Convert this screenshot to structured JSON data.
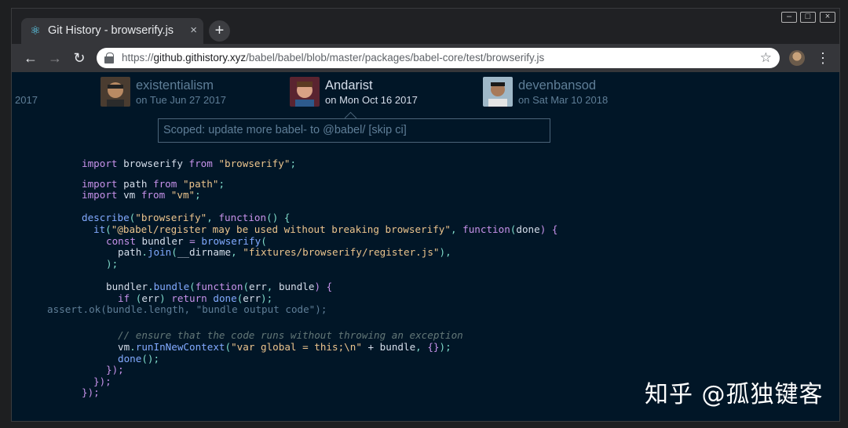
{
  "browser": {
    "tab": {
      "title": "Git History - browserify.js",
      "favicon": "react-icon",
      "close_glyph": "×"
    },
    "new_tab_glyph": "+",
    "window_controls": [
      "minimize",
      "maximize",
      "close"
    ],
    "nav": {
      "back": "←",
      "forward": "→",
      "reload": "↻"
    },
    "url": {
      "scheme": "https://",
      "host": "github.githistory.xyz",
      "path": "/babel/babel/blob/master/packages/babel-core/test/browserify.js"
    },
    "bookmark_glyph": "☆",
    "menu_glyph": "⋮"
  },
  "timeline": {
    "year_stub": "2017",
    "commits": [
      {
        "author": "existentialism",
        "date": "on Tue Jun 27 2017",
        "state": "inactive"
      },
      {
        "author": "Andarist",
        "date": "on Mon Oct 16 2017",
        "state": "active"
      },
      {
        "author": "devenbansod",
        "date": "on Sat Mar 10 2018",
        "state": "inactive"
      }
    ],
    "commit_message": "Scoped: update more babel- to @babel/ [skip ci]"
  },
  "code": {
    "l1": [
      "import",
      " browserify ",
      "from",
      " ",
      "\"browserify\"",
      ";"
    ],
    "l2": [
      "import",
      " path ",
      "from",
      " ",
      "\"path\"",
      ";"
    ],
    "l3": [
      "import",
      " vm ",
      "from",
      " ",
      "\"vm\"",
      ";"
    ],
    "l4": [
      "describe",
      "(",
      "\"browserify\"",
      ", ",
      "function",
      "() {"
    ],
    "l5": [
      "it",
      "(",
      "\"@babel/register may be used without breaking browserify\"",
      ", ",
      "function",
      "(",
      "done",
      ") {"
    ],
    "l6": [
      "const",
      " bundler ",
      "=",
      " ",
      "browserify",
      "("
    ],
    "l7": [
      "path",
      ".",
      "join",
      "(",
      "__dirname",
      ", ",
      "\"fixtures/browserify/register.js\"",
      "),"
    ],
    "l8": [
      ");"
    ],
    "l9": [
      "bundler",
      ".",
      "bundle",
      "(",
      "function",
      "(",
      "err",
      ", ",
      "bundle",
      ") {"
    ],
    "l10": [
      "if",
      " (",
      "err",
      ") ",
      "return",
      " ",
      "done",
      "(",
      "err",
      ");"
    ],
    "l11": [
      "assert",
      ".",
      "ok",
      "(",
      "bundle",
      ".",
      "length",
      ", ",
      "\"bundle output code\"",
      ");"
    ],
    "l12": "// ensure that the code runs without throwing an exception",
    "l13": [
      "vm",
      ".",
      "runInNewContext",
      "(",
      "\"var global = this;\\n\"",
      " + ",
      "bundle",
      ", ",
      "{}",
      ");"
    ],
    "l14": [
      "done",
      "();"
    ],
    "l15": "});",
    "l16": "});",
    "l17": "});"
  },
  "watermark": "知乎 @孤独键客",
  "colors": {
    "editor_bg": "#011627",
    "keyword": "#c792ea",
    "function": "#82aaff",
    "string": "#ecc48d",
    "punctuation": "#7fdbca",
    "comment": "#637777"
  }
}
